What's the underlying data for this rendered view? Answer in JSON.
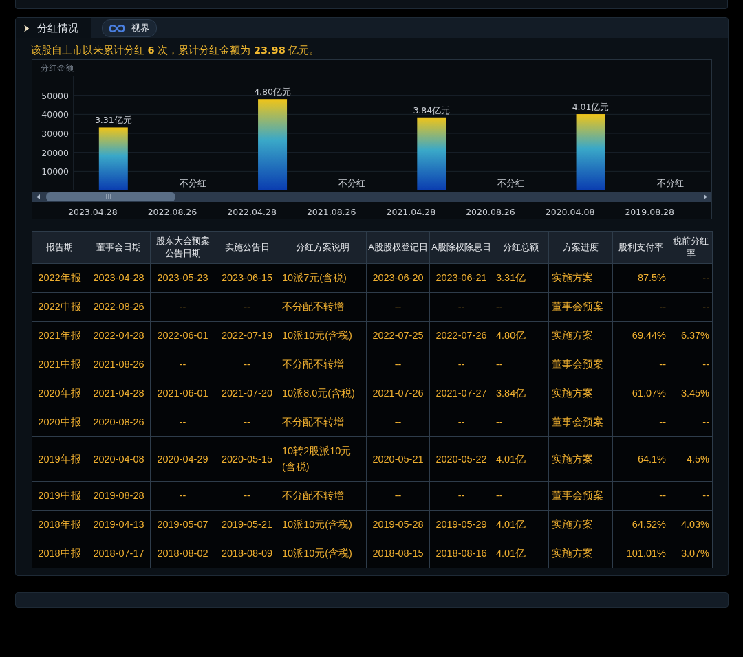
{
  "section": {
    "title": "分红情况",
    "badge": "视界"
  },
  "summary": "该股自上市以来累计分红 **6** 次，累计分红金额为 **23.98** 亿元。",
  "chart": {
    "chart_data": {
      "type": "bar",
      "ylabel": "分红金额",
      "categories": [
        "2023.04.28",
        "2022.08.26",
        "2022.04.28",
        "2021.08.26",
        "2021.04.28",
        "2020.08.26",
        "2020.04.08",
        "2019.08.28"
      ],
      "values": [
        33100,
        0,
        48000,
        0,
        38400,
        0,
        40100,
        0
      ],
      "ylim": [
        0,
        60000
      ],
      "yticks": [
        10000,
        20000,
        30000,
        40000,
        50000
      ],
      "grid": true
    },
    "bar_labels": [
      "3.31亿元",
      "不分红",
      "4.80亿元",
      "不分红",
      "3.84亿元",
      "不分红",
      "4.01亿元",
      "不分红"
    ]
  },
  "table": {
    "columns": [
      "报告期",
      "董事会日期",
      "股东大会预案公告日期",
      "实施公告日",
      "分红方案说明",
      "A股股权登记日",
      "A股除权除息日",
      "分红总额",
      "方案进度",
      "股利支付率",
      "税前分红率"
    ],
    "rows": [
      [
        "2022年报",
        "2023-04-28",
        "2023-05-23",
        "2023-06-15",
        "10派7元(含税)",
        "2023-06-20",
        "2023-06-21",
        "3.31亿",
        "实施方案",
        "87.5%",
        "--"
      ],
      [
        "2022中报",
        "2022-08-26",
        "--",
        "--",
        "不分配不转增",
        "--",
        "--",
        "--",
        "董事会预案",
        "--",
        "--"
      ],
      [
        "2021年报",
        "2022-04-28",
        "2022-06-01",
        "2022-07-19",
        "10派10元(含税)",
        "2022-07-25",
        "2022-07-26",
        "4.80亿",
        "实施方案",
        "69.44%",
        "6.37%"
      ],
      [
        "2021中报",
        "2021-08-26",
        "--",
        "--",
        "不分配不转增",
        "--",
        "--",
        "--",
        "董事会预案",
        "--",
        "--"
      ],
      [
        "2020年报",
        "2021-04-28",
        "2021-06-01",
        "2021-07-20",
        "10派8.0元(含税)",
        "2021-07-26",
        "2021-07-27",
        "3.84亿",
        "实施方案",
        "61.07%",
        "3.45%"
      ],
      [
        "2020中报",
        "2020-08-26",
        "--",
        "--",
        "不分配不转增",
        "--",
        "--",
        "--",
        "董事会预案",
        "--",
        "--"
      ],
      [
        "2019年报",
        "2020-04-08",
        "2020-04-29",
        "2020-05-15",
        "10转2股派10元(含税)",
        "2020-05-21",
        "2020-05-22",
        "4.01亿",
        "实施方案",
        "64.1%",
        "4.5%"
      ],
      [
        "2019中报",
        "2019-08-28",
        "--",
        "--",
        "不分配不转增",
        "--",
        "--",
        "--",
        "董事会预案",
        "--",
        "--"
      ],
      [
        "2018年报",
        "2019-04-13",
        "2019-05-07",
        "2019-05-21",
        "10派10元(含税)",
        "2019-05-28",
        "2019-05-29",
        "4.01亿",
        "实施方案",
        "64.52%",
        "4.03%"
      ],
      [
        "2018中报",
        "2018-07-17",
        "2018-08-02",
        "2018-08-09",
        "10派10元(含税)",
        "2018-08-15",
        "2018-08-16",
        "4.01亿",
        "实施方案",
        "101.01%",
        "3.07%"
      ]
    ]
  }
}
